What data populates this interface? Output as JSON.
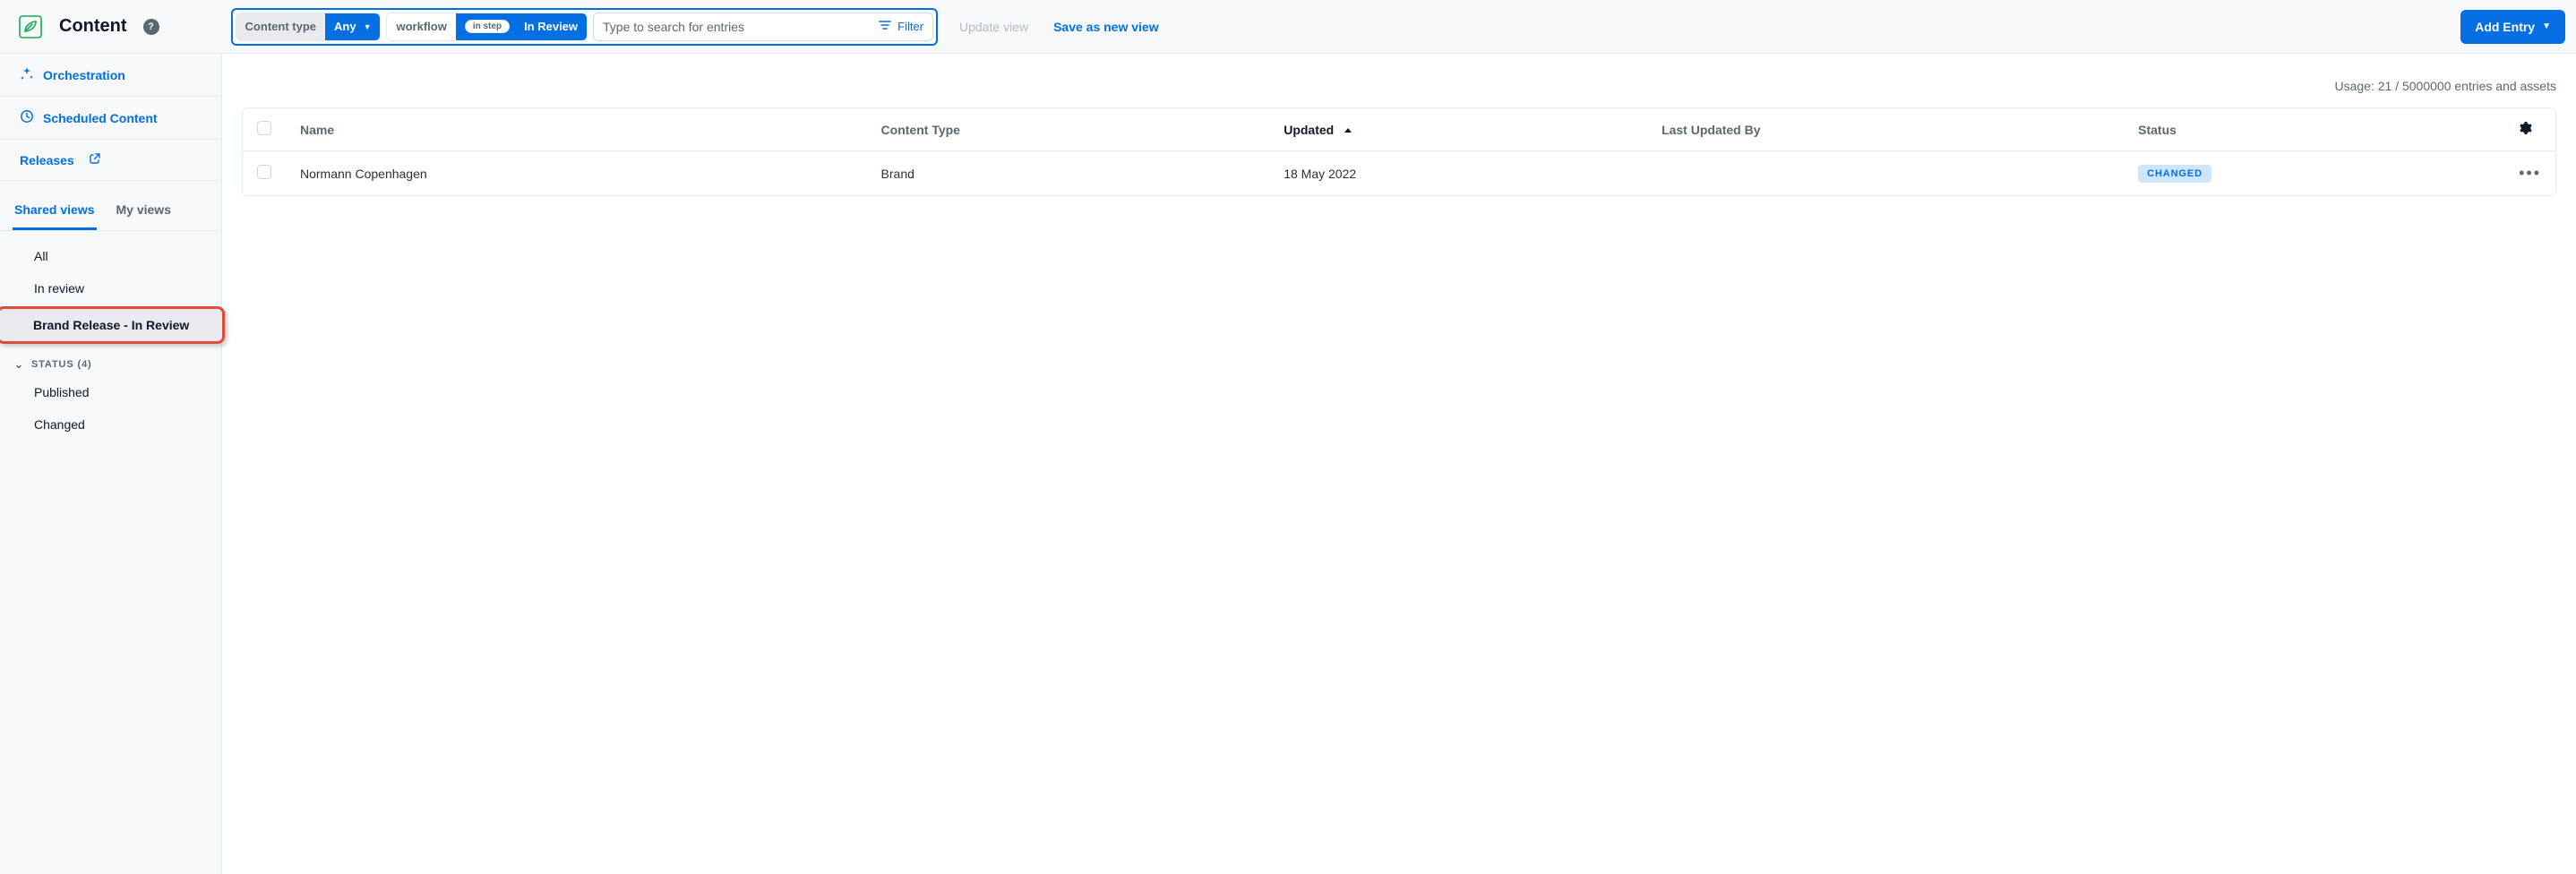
{
  "header": {
    "title": "Content",
    "help_tooltip": "?"
  },
  "filters": {
    "content_type_label": "Content type",
    "content_type_value": "Any",
    "workflow_label": "workflow",
    "workflow_step_badge": "in step",
    "workflow_value": "In Review"
  },
  "search": {
    "placeholder": "Type to search for entries",
    "filter_label": "Filter"
  },
  "actions": {
    "update_view": "Update view",
    "save_as_new_view": "Save as new view",
    "add_entry": "Add Entry"
  },
  "sidebar": {
    "orchestration": "Orchestration",
    "scheduled_content": "Scheduled Content",
    "releases": "Releases",
    "tabs": {
      "shared": "Shared views",
      "my": "My views"
    },
    "views": {
      "all": "All",
      "in_review": "In review",
      "brand_release": "Brand Release - In Review"
    },
    "status_header": "STATUS (4)",
    "statuses": {
      "published": "Published",
      "changed": "Changed"
    }
  },
  "usage": "Usage: 21 / 5000000 entries and assets",
  "table": {
    "columns": {
      "name": "Name",
      "content_type": "Content Type",
      "updated": "Updated",
      "last_updated_by": "Last Updated By",
      "status": "Status"
    },
    "rows": [
      {
        "name": "Normann Copenhagen",
        "content_type": "Brand",
        "updated": "18 May 2022",
        "last_updated_by": "",
        "status": "CHANGED"
      }
    ]
  }
}
